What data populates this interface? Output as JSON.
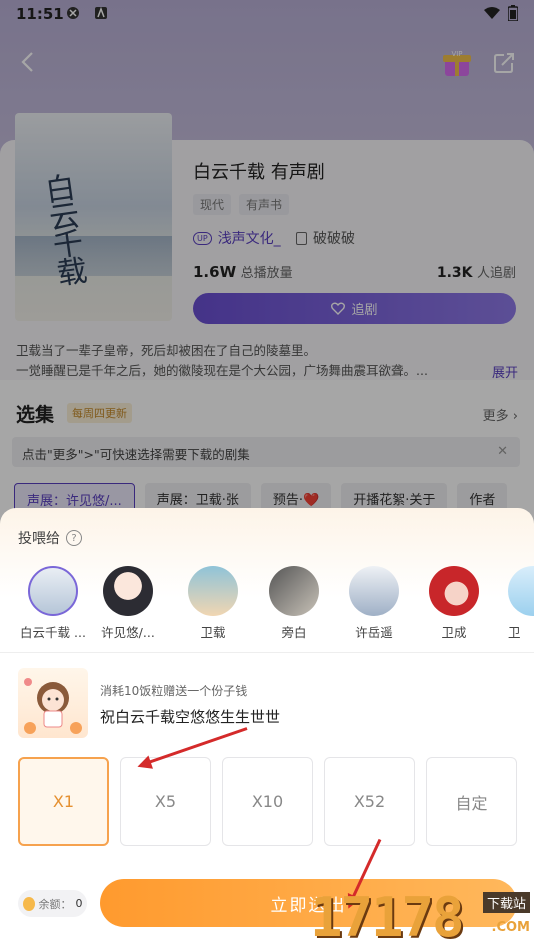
{
  "status_bar": {
    "time": "11:51"
  },
  "drama": {
    "title": "白云千载  有声剧",
    "tags": [
      "现代",
      "有声书"
    ],
    "up_badge": "UP",
    "uploader": "浅声文化_",
    "author": "破破破",
    "plays": "1.6W",
    "plays_label": "总播放量",
    "followers": "1.3K",
    "followers_label": "人追剧",
    "follow_label": "追剧",
    "cover_title": "白云千载",
    "description": "卫载当了一辈子皇帝，死后却被困在了自己的陵墓里。\n一觉睡醒已是千年之后，她的徽陵现在是个大公园，广场舞曲震耳欲聋。...",
    "expand_label": "展开"
  },
  "episodes": {
    "section_title": "选集",
    "update_badge": "每周四更新",
    "more_label": "更多",
    "tip": "点击\"更多\">\"可快速选择需要下载的剧集",
    "items": [
      "声展：许见悠/...",
      "声展：卫载·张",
      "预告·❤️",
      "开播花絮·关于",
      "作者"
    ]
  },
  "gift_sheet": {
    "title": "投喂给",
    "recipients": [
      "白云千载 ...",
      "许见悠/...",
      "卫载",
      "旁白",
      "许岳遥",
      "卫成",
      "卫"
    ],
    "cost_text": "消耗10饭粒赠送一个份子钱",
    "message": "祝白云千载空悠悠生生世世",
    "options": [
      "X1",
      "X5",
      "X10",
      "X52",
      "自定"
    ],
    "balance_label": "余额：",
    "balance_value": "0",
    "send_label": "立即送出"
  },
  "watermark": {
    "number": "17178",
    "tag1": "下载站",
    "tag2": ".COM"
  },
  "colors": {
    "accent": "#6a4fd2",
    "orange": "#ff9a2e",
    "arrow": "#d42a2a"
  }
}
